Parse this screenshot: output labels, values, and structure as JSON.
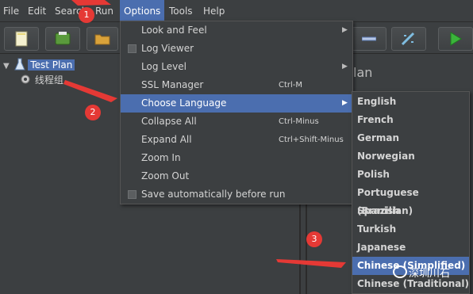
{
  "menubar": {
    "file": "File",
    "edit": "Edit",
    "search": "Search",
    "run": "Run",
    "options": "Options",
    "tools": "Tools",
    "help": "Help"
  },
  "tree": {
    "test_plan": "Test Plan",
    "thread_group": "线程组"
  },
  "right_panel": {
    "title_fragment": "lan"
  },
  "options_menu": {
    "items": [
      {
        "label": "Look and Feel",
        "shortcut": "",
        "submenu": true
      },
      {
        "label": "Log Viewer",
        "shortcut": "",
        "checkbox": true
      },
      {
        "label": "Log Level",
        "shortcut": "",
        "submenu": true
      },
      {
        "label": "SSL Manager",
        "shortcut": "Ctrl-M"
      },
      {
        "label": "Choose Language",
        "shortcut": "",
        "submenu": true,
        "highlighted": true
      },
      {
        "label": "Collapse All",
        "shortcut": "Ctrl-Minus"
      },
      {
        "label": "Expand All",
        "shortcut": "Ctrl+Shift-Minus"
      },
      {
        "label": "Zoom In",
        "shortcut": ""
      },
      {
        "label": "Zoom Out",
        "shortcut": ""
      },
      {
        "label": "Save automatically before run",
        "shortcut": "",
        "checkbox": true
      }
    ]
  },
  "language_menu": {
    "items": [
      "English",
      "French",
      "German",
      "Norwegian",
      "Polish",
      "Portuguese (Brazilian)",
      "Spanish",
      "Turkish",
      "Japanese",
      "Chinese (Simplified)",
      "Chinese (Traditional)"
    ],
    "selected": "Chinese (Simplified)"
  },
  "annotations": {
    "step1": "1",
    "step2": "2",
    "step3": "3",
    "color": "#e53935"
  },
  "watermark": {
    "text": "深圳川石"
  },
  "colors": {
    "background": "#3c3f41",
    "highlight": "#4b6eaf",
    "text": "#d4d4d4"
  }
}
